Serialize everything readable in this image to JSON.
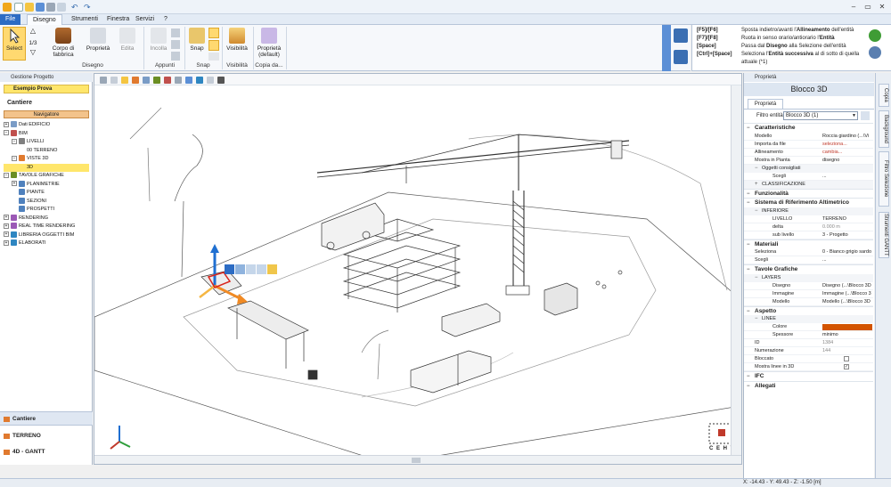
{
  "quick_access_icons": [
    "app-logo-icon",
    "new-icon",
    "open-icon",
    "save-icon",
    "print-icon",
    "preview-icon",
    "undo-icon",
    "redo-icon"
  ],
  "window": {
    "minimize": "–",
    "maximize": "▭",
    "close": "✕"
  },
  "menu_tabs": [
    {
      "label": "File",
      "file": true
    },
    {
      "label": "Disegno",
      "active": true
    },
    {
      "label": "Strumenti"
    },
    {
      "label": "Finestra"
    },
    {
      "label": "Servizi"
    },
    {
      "label": "?"
    }
  ],
  "ribbon": {
    "select": "Select",
    "fraction": "1/3",
    "corpo": "Corpo di fabbrica",
    "proprieta": "Proprietà",
    "edita": "Edita",
    "incolla": "Incolla",
    "snap": "Snap",
    "visibilita": "Visibilità",
    "proprieta_default": "Proprietà (default)",
    "groups": {
      "disegno": "Disegno",
      "appunti": "Appunti",
      "snap": "Snap",
      "visibilita": "Visibilità",
      "copia": "Copia da..."
    }
  },
  "help_lines": [
    {
      "key": "[F5]/[F6]",
      "text": "Sposta indietro/avanti l'",
      "bold": "Allineamento",
      "rest": " dell'entità"
    },
    {
      "key": "[F7]/[F8]",
      "text": "Ruota in senso orario/antiorario l'",
      "bold": "Entità",
      "rest": ""
    },
    {
      "key": "[Space]",
      "text": "Passa dal ",
      "bold": "Disegno",
      "rest": " alla Selezione dell'entità"
    },
    {
      "key": "[Ctrl]+[Space]",
      "text": "Seleziona l'",
      "bold": "Entità successiva",
      "rest": " al di sotto di quella"
    },
    {
      "key": "",
      "text": "attuale (*1)",
      "bold": "",
      "rest": ""
    }
  ],
  "left": {
    "panel_title": "Gestione Progetto",
    "project": "Esempio Prova",
    "cantiere_title": "Cantiere",
    "navigatore": "Navigatore",
    "tree": [
      {
        "label": "Dati EDIFICIO",
        "indent": 0,
        "exp": "+",
        "icon": "#7a9cc6"
      },
      {
        "label": "BIM",
        "indent": 0,
        "exp": "−",
        "icon": "#c0504d"
      },
      {
        "label": "LIVELLI",
        "indent": 1,
        "exp": "−",
        "icon": "#808080"
      },
      {
        "label": "00 TERRENO",
        "indent": 2,
        "exp": "",
        "icon": ""
      },
      {
        "label": "VISTE 3D",
        "indent": 1,
        "exp": "−",
        "icon": "#e07a2f"
      },
      {
        "label": "3D",
        "indent": 2,
        "exp": "",
        "icon": "",
        "selected": true
      },
      {
        "label": "TAVOLE GRAFICHE",
        "indent": 0,
        "exp": "−",
        "icon": "#6b8e23"
      },
      {
        "label": "PLANIMETRIE",
        "indent": 1,
        "exp": "+",
        "icon": "#4f81bd"
      },
      {
        "label": "PIANTE",
        "indent": 1,
        "exp": "",
        "icon": "#4f81bd"
      },
      {
        "label": "SEZIONI",
        "indent": 1,
        "exp": "",
        "icon": "#4f81bd"
      },
      {
        "label": "PROSPETTI",
        "indent": 1,
        "exp": "",
        "icon": "#4f81bd"
      },
      {
        "label": "RENDERING",
        "indent": 0,
        "exp": "+",
        "icon": "#9b59b6"
      },
      {
        "label": "REAL TIME RENDERING",
        "indent": 0,
        "exp": "+",
        "icon": "#9b59b6"
      },
      {
        "label": "LIBRERIA OGGETTI BIM",
        "indent": 0,
        "exp": "+",
        "icon": "#2e86c1"
      },
      {
        "label": "ELABORATI",
        "indent": 0,
        "exp": "+",
        "icon": "#2e86c1"
      }
    ],
    "bottom_nav": [
      {
        "label": "Cantiere",
        "active": true
      },
      {
        "label": "TERRENO"
      },
      {
        "label": "4D - GANTT"
      }
    ]
  },
  "view_cube": "C E H V",
  "properties": {
    "panel_title": "Proprietà",
    "object_title": "Blocco 3D",
    "tab": "Proprietà",
    "filter_label": "Filtro entità",
    "filter_value": "Blocco 3D (1)",
    "sections": [
      {
        "title": "Caratteristiche",
        "rows": [
          {
            "k": "Modello",
            "v": "Roccia giardino  (...\\Vi"
          },
          {
            "k": "Importa da file",
            "v": "seleziona...",
            "red": true
          },
          {
            "k": "Allineamento",
            "v": "cambia...",
            "red": true
          },
          {
            "k": "Mostra in Pianta",
            "v": "disegno"
          }
        ],
        "subs": [
          {
            "title": "Oggetti consigliati",
            "rows": [
              {
                "k": "Scegli",
                "v": "..."
              }
            ]
          },
          {
            "title": "CLASSIFICAZIONE",
            "rows": []
          }
        ]
      },
      {
        "title": "Funzionalità",
        "rows": [],
        "subs": []
      },
      {
        "title": "Sistema di Riferimento Altimetrico",
        "rows": [],
        "subs": [
          {
            "title": "INFERIORE",
            "rows": [
              {
                "k": "LIVELLO",
                "v": "TERRENO"
              },
              {
                "k": "delta",
                "v": "0.000 m",
                "grey": true
              },
              {
                "k": "sub livello",
                "v": "3 - Progetto"
              }
            ]
          }
        ]
      },
      {
        "title": "Materiali",
        "rows": [
          {
            "k": "Seleziona",
            "v": "0 - Bianco grigio sardo"
          },
          {
            "k": "Scegli",
            "v": "..."
          }
        ],
        "subs": []
      },
      {
        "title": "Tavole Grafiche",
        "rows": [],
        "subs": [
          {
            "title": "LAYERS",
            "rows": [
              {
                "k": "Disegno",
                "v": "Disegno  (...\\Blocco 3D"
              },
              {
                "k": "Immagine",
                "v": "Immagine  (...\\Blocco 3"
              },
              {
                "k": "Modello",
                "v": "Modello  (...\\Blocco 3D"
              }
            ]
          }
        ]
      },
      {
        "title": "Aspetto",
        "rows": [],
        "subs": [
          {
            "title": "LINEE",
            "rows": [
              {
                "k": "Colore",
                "v": "",
                "swatch": "#d35400"
              },
              {
                "k": "Spessore",
                "v": "minimo"
              }
            ]
          }
        ],
        "after": [
          {
            "k": "ID",
            "v": "1384",
            "grey": true
          },
          {
            "k": "Numerazione",
            "v": "144",
            "grey": true
          },
          {
            "k": "Bloccato",
            "v": "",
            "check": false
          },
          {
            "k": "Mostra linee in 3D",
            "v": "",
            "check": true
          }
        ]
      },
      {
        "title": "IFC",
        "rows": [],
        "subs": []
      },
      {
        "title": "Allegati",
        "rows": [],
        "subs": []
      }
    ]
  },
  "side_tabs": [
    "Copia",
    "Background",
    "Filtro Selezione",
    "Strumenti GANTT"
  ],
  "status_coords": "X: -14.43 - Y: 49.43 - Z: -1.50 [m]",
  "colors": {
    "accent": "#2c6cc4",
    "highlight": "#ffe66b",
    "navigator": "#f3c38b",
    "selection_red": "#d9261c",
    "axis_blue": "#1f6fd1",
    "axis_orange": "#f08a24"
  }
}
